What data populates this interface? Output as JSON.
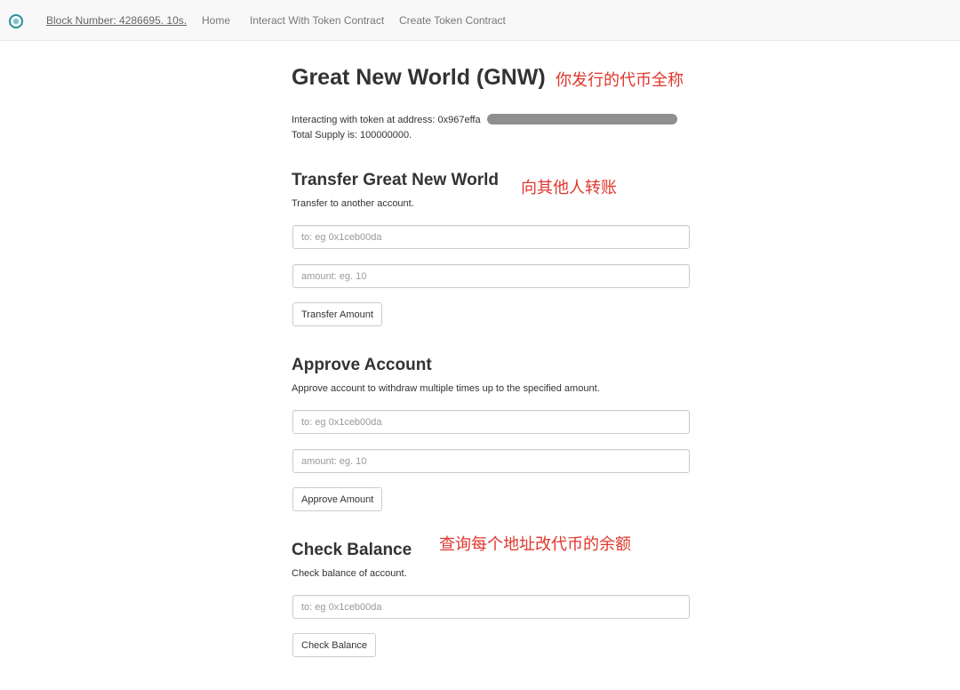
{
  "nav": {
    "block_number": "Block Number: 4286695. 10s.",
    "home": "Home",
    "interact": "Interact With Token Contract",
    "create": "Create Token Contract",
    "logo_color": "#2a8f9a"
  },
  "header": {
    "title": "Great New World (GNW)",
    "title_annotation": "你发行的代币全称",
    "address_label": "Interacting with token at address: 0x967effa",
    "total_supply": "Total Supply is: 100000000."
  },
  "transfer": {
    "heading": "Transfer Great New World",
    "annotation": "向其他人转账",
    "description": "Transfer to another account.",
    "to_placeholder": "to: eg 0x1ceb00da",
    "amount_placeholder": "amount: eg. 10",
    "button_label": "Transfer Amount"
  },
  "approve": {
    "heading": "Approve Account",
    "description": "Approve account to withdraw multiple times up to the specified amount.",
    "to_placeholder": "to: eg 0x1ceb00da",
    "amount_placeholder": "amount: eg. 10",
    "button_label": "Approve Amount"
  },
  "balance": {
    "heading": "Check Balance",
    "annotation": "查询每个地址改代币的余额",
    "description": "Check balance of account.",
    "to_placeholder": "to: eg 0x1ceb00da",
    "button_label": "Check Balance"
  },
  "colors": {
    "annotation_red": "#e0362c",
    "navbar_bg": "#f8f8f8"
  }
}
